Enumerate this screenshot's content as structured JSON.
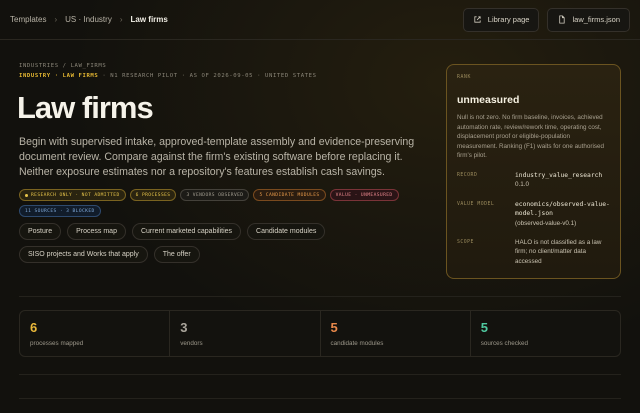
{
  "breadcrumb": {
    "items": [
      "Templates",
      "US · Industry",
      "Law firms"
    ]
  },
  "top_actions": {
    "library": "Library page",
    "json": "law_firms.json"
  },
  "header": {
    "path": "INDUSTRIES / LAW_FIRMS",
    "meta_highlight": "INDUSTRY · LAW FIRMS",
    "meta_rest": " · N1 RESEARCH PILOT · AS OF 2026-09-05 · UNITED STATES",
    "title": "Law firms",
    "lede": "Begin with supervised intake, approved-template assembly and evidence-preserving document review. Compare against the firm's existing software before replacing it. Neither exposure estimates nor a repository's features establish cash savings."
  },
  "badges": [
    {
      "label": "RESEARCH ONLY · NOT ADMITTED",
      "color": "yellow"
    },
    {
      "label": "6 PROCESSES",
      "color": "yellow"
    },
    {
      "label": "3 VENDORS OBSERVED",
      "color": "gray"
    },
    {
      "label": "5 CANDIDATE MODULES",
      "color": "orange"
    },
    {
      "label": "VALUE · UNMEASURED",
      "color": "red"
    },
    {
      "label": "11 SOURCES · 3 BLOCKED",
      "color": "blue"
    }
  ],
  "tabs": [
    "Posture",
    "Process map",
    "Current marketed capabilities",
    "Candidate modules",
    "SISO projects and Works that apply",
    "The offer"
  ],
  "rank_card": {
    "label": "RANK",
    "value": "unmeasured",
    "note": "Null is not zero. No firm baseline, invoices, achieved automation rate, review/rework time, operating cost, displacement proof or eligible-population measurement. Ranking (F1) waits for one authorised firm's pilot.",
    "record_key": "RECORD",
    "record_code": "industry_value_research",
    "record_ver": "0.1.0",
    "model_key": "VALUE MODEL",
    "model_code": "economics/observed-value-model.json",
    "model_ver": "(observed-value-v0.1)",
    "scope_key": "SCOPE",
    "scope_text": "HALO is not classified as a law firm; no client/matter data accessed"
  },
  "stats": [
    {
      "num": "6",
      "cap": "processes mapped",
      "color": "yellow"
    },
    {
      "num": "3",
      "cap": "vendors",
      "color": "gray"
    },
    {
      "num": "5",
      "cap": "candidate modules",
      "color": "orange"
    },
    {
      "num": "5",
      "cap": "sources checked",
      "color": "green"
    }
  ],
  "colors": {
    "accent": "#e6b832",
    "card_border": "#6b5420",
    "background": "#12110d"
  }
}
